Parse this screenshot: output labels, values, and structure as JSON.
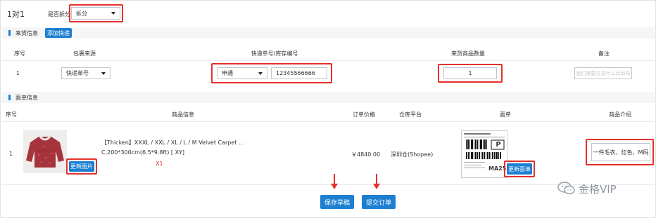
{
  "header": {
    "title": "1对1",
    "split_label": "是否拆分",
    "split_value": "拆分"
  },
  "source_section": {
    "title": "来货信息",
    "add_express_button": "添加快递",
    "columns": [
      "序号",
      "包裹来源",
      "快递单号/库存编号",
      "来货商品数量",
      "备注"
    ],
    "row": {
      "index": "1",
      "package_source": "快递单号",
      "courier": "申通",
      "tracking_number": "12345566666",
      "quantity": "1",
      "remark_placeholder": "我们需要注意什么比如布"
    }
  },
  "order_section": {
    "title": "面单信息",
    "columns": [
      "序号",
      "商品信息",
      "订单价格",
      "仓库平台",
      "面单",
      "商品介绍"
    ],
    "row": {
      "index": "1",
      "product_line1": "【Thicken】XXXL / XXL / XL / L / M Velvet Carpet ...",
      "product_line2": "C,200*300cm(6.5*9.8ft) [ XY]",
      "qty_badge": "X1",
      "update_image_button": "更新图片",
      "price": "￥4840.00",
      "warehouse": "深圳仓(Shopee)",
      "label_letter": "P",
      "label_code": "MA25",
      "update_label_button": "更新面单",
      "description": "一件毛衣，红色，M码"
    }
  },
  "footer": {
    "save_draft_button": "保存草稿",
    "submit_order_button": "提交订单"
  },
  "watermark": "金格VIP",
  "colors": {
    "accent": "#1c7fd1",
    "highlight": "#e5302a",
    "section_bg": "#f4f6f8"
  }
}
